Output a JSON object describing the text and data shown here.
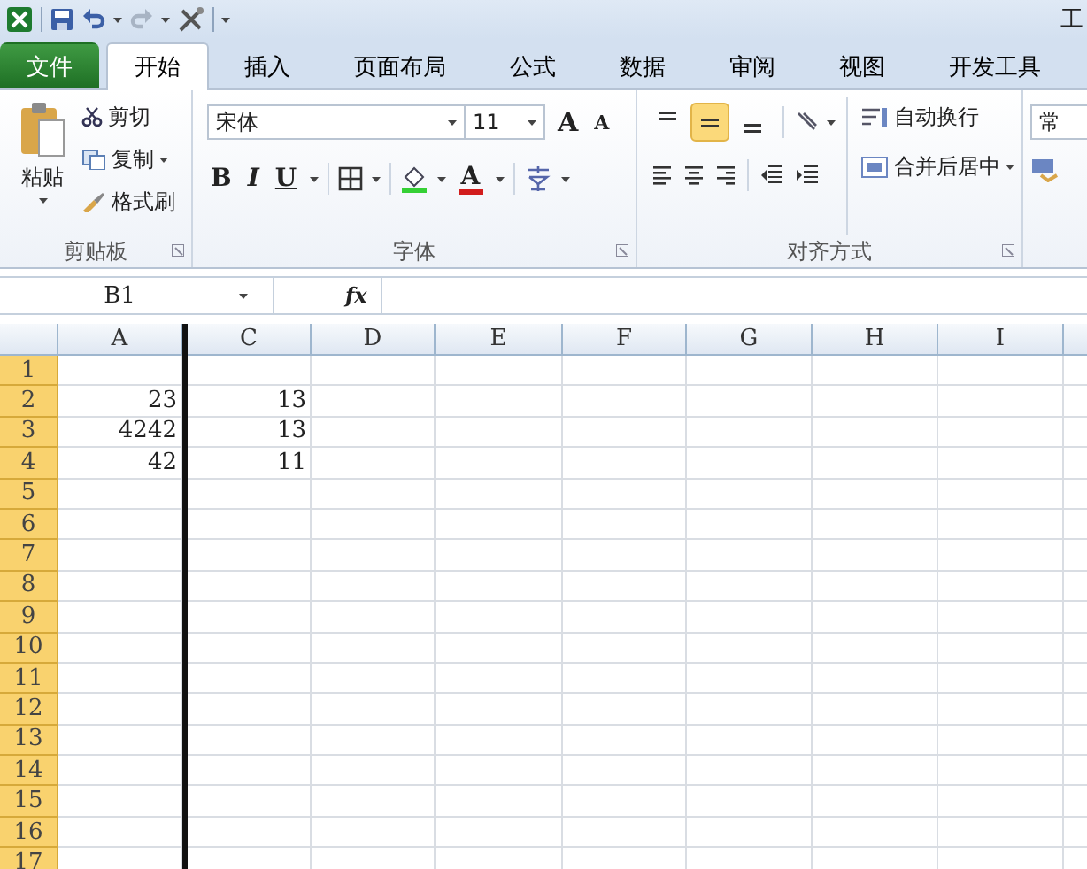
{
  "title_bar": {
    "title": "工"
  },
  "tabs": [
    {
      "label": "文件",
      "kind": "file",
      "selected": false
    },
    {
      "label": "开始",
      "kind": "tab",
      "selected": true
    },
    {
      "label": "插入",
      "kind": "tab",
      "selected": false
    },
    {
      "label": "页面布局",
      "kind": "tab",
      "selected": false
    },
    {
      "label": "公式",
      "kind": "tab",
      "selected": false
    },
    {
      "label": "数据",
      "kind": "tab",
      "selected": false
    },
    {
      "label": "审阅",
      "kind": "tab",
      "selected": false
    },
    {
      "label": "视图",
      "kind": "tab",
      "selected": false
    },
    {
      "label": "开发工具",
      "kind": "tab",
      "selected": false
    }
  ],
  "clipboard": {
    "paste": "粘贴",
    "cut": "剪切",
    "copy": "复制",
    "format_painter": "格式刷",
    "label": "剪贴板"
  },
  "font": {
    "name": "宋体",
    "size": "11",
    "grow": "A",
    "shrink": "A",
    "bold": "B",
    "italic": "I",
    "underline": "U",
    "font_color": "A",
    "label": "字体"
  },
  "alignment": {
    "vertical": [
      {
        "selected": false
      },
      {
        "selected": true
      },
      {
        "selected": false
      }
    ],
    "wrap": "自动换行",
    "merge": "合并后居中",
    "label": "对齐方式"
  },
  "number": {
    "format": "常"
  },
  "formula_bar": {
    "name_box": "B1",
    "fx": "fx"
  },
  "columns": [
    "A",
    "C",
    "D",
    "E",
    "F",
    "G",
    "H",
    "I"
  ],
  "rows": [
    {
      "header": "1",
      "selected": true
    },
    {
      "header": "2",
      "selected": true,
      "values": [
        "23",
        "13"
      ]
    },
    {
      "header": "3",
      "selected": true,
      "values": [
        "4242",
        "13"
      ]
    },
    {
      "header": "4",
      "selected": true,
      "values": [
        "42",
        "11"
      ]
    },
    {
      "header": "5",
      "selected": true
    },
    {
      "header": "6",
      "selected": true
    },
    {
      "header": "7",
      "selected": true
    },
    {
      "header": "8",
      "selected": true
    },
    {
      "header": "9",
      "selected": true
    },
    {
      "header": "10",
      "selected": true
    },
    {
      "header": "11",
      "selected": true
    },
    {
      "header": "12",
      "selected": true
    },
    {
      "header": "13",
      "selected": true
    },
    {
      "header": "14",
      "selected": true
    },
    {
      "header": "15",
      "selected": true
    },
    {
      "header": "16",
      "selected": true
    },
    {
      "header": "17",
      "selected": true
    }
  ]
}
